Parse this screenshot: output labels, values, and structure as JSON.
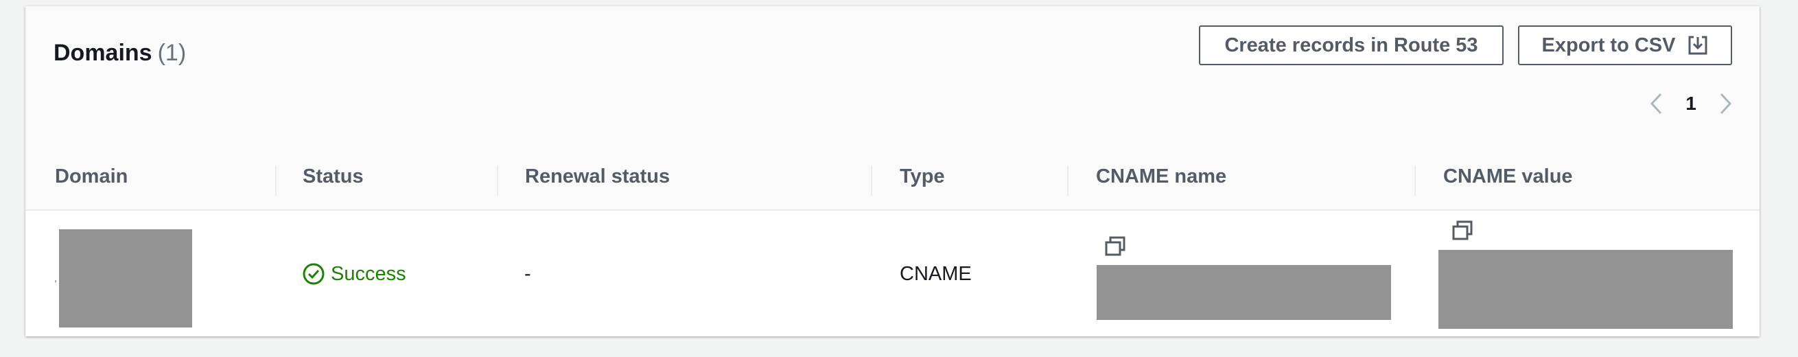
{
  "header": {
    "title": "Domains",
    "count": "(1)",
    "buttons": {
      "route53_label": "Create records in Route 53",
      "export_label": "Export to CSV"
    },
    "pagination": {
      "current_page": "1"
    }
  },
  "table": {
    "columns": [
      "Domain",
      "Status",
      "Renewal status",
      "Type",
      "CNAME name",
      "CNAME value"
    ],
    "rows": [
      {
        "domain": "",
        "status": "Success",
        "renewal_status": "-",
        "type": "CNAME",
        "cname_name": "",
        "cname_value": ""
      }
    ]
  },
  "icons": {
    "export": "download-icon",
    "prev": "chevron-left-icon",
    "next": "chevron-right-icon",
    "status": "check-circle-icon",
    "copy": "copy-icon"
  },
  "colors": {
    "success": "#1d8102",
    "button_border": "#545b64",
    "header_bg": "#fafafa",
    "redaction": "#939393"
  }
}
